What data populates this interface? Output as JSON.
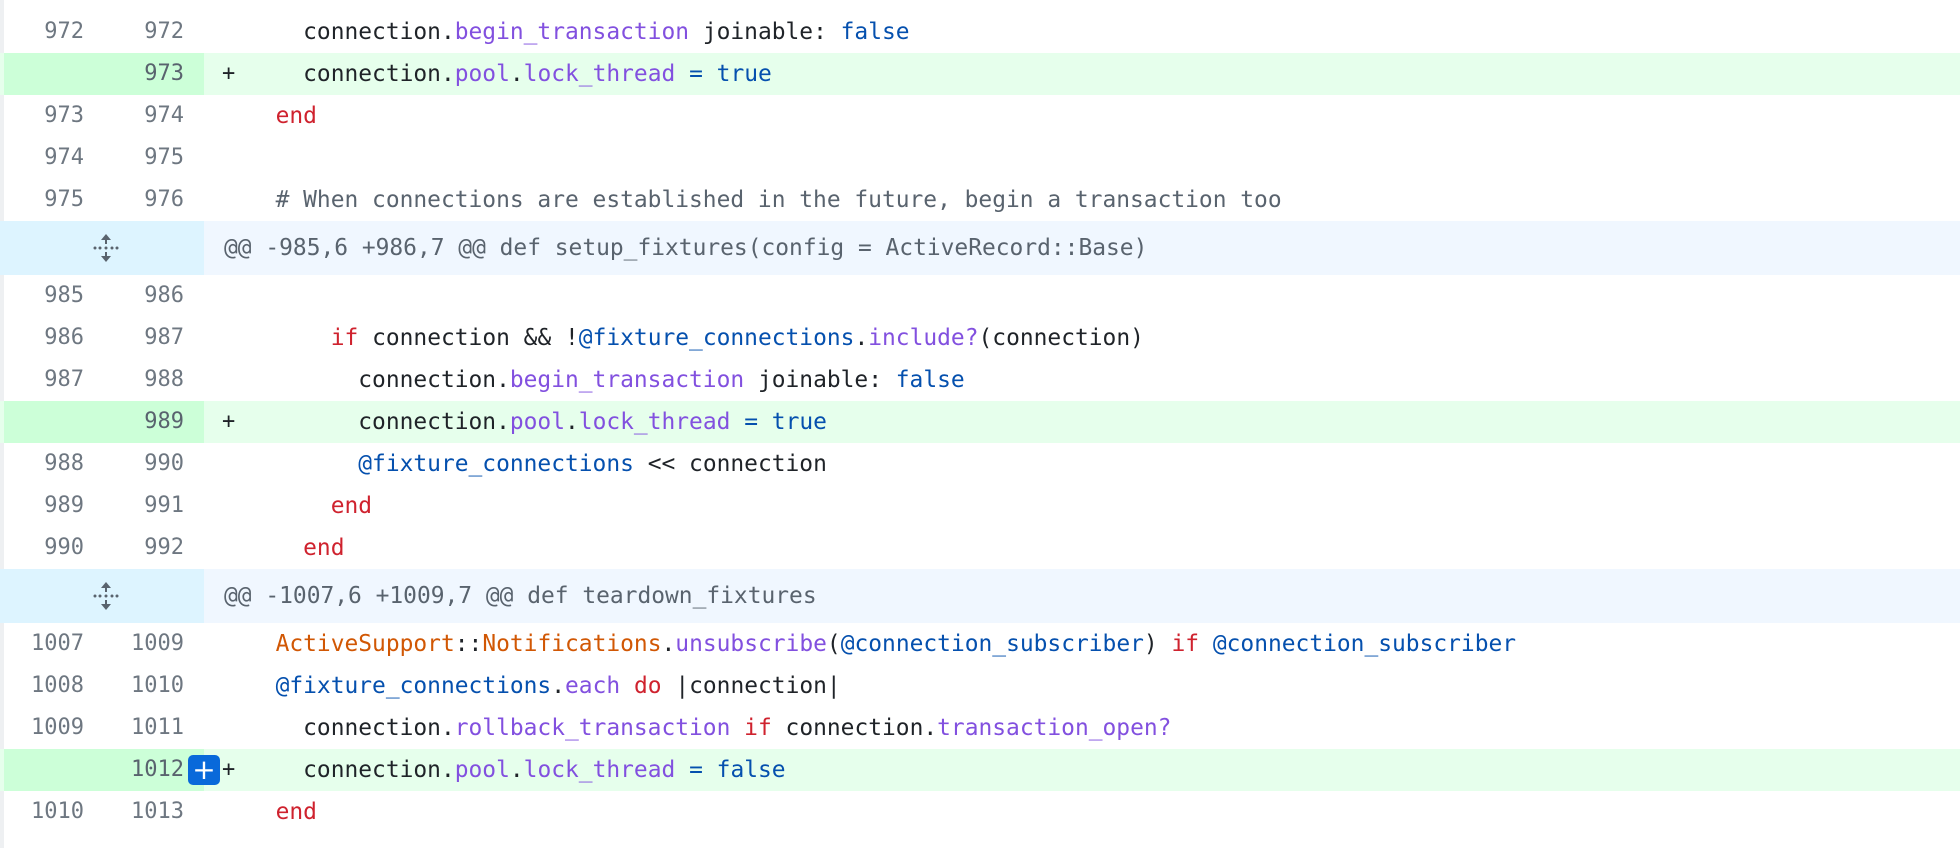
{
  "colors": {
    "keyword": "#cf222e",
    "method": "#8250df",
    "constant": "#0550ae",
    "instance_var": "#0550ae",
    "class_name": "#d15704",
    "comment": "#59636e",
    "added_background": "#e6ffec",
    "added_gutter": "#ccffd8",
    "hunk_background": "#f0f7ff",
    "add_comment_button": "#0969da"
  },
  "icons": {
    "expand": "expand-arrows-icon",
    "add_comment": "plus-icon"
  },
  "add_button_label": "+",
  "lines": [
    {
      "type": "ctx",
      "old": "972",
      "new": "972",
      "marker": "",
      "tokens": [
        {
          "t": "    connection."
        },
        {
          "t": "begin_transaction",
          "c": "mt"
        },
        {
          "t": " joinable: "
        },
        {
          "t": "false",
          "c": "const"
        }
      ]
    },
    {
      "type": "add",
      "old": "",
      "new": "973",
      "marker": "+",
      "tokens": [
        {
          "t": "    connection."
        },
        {
          "t": "pool",
          "c": "mt"
        },
        {
          "t": "."
        },
        {
          "t": "lock_thread",
          "c": "mt"
        },
        {
          "t": " "
        },
        {
          "t": "=",
          "c": "const"
        },
        {
          "t": " "
        },
        {
          "t": "true",
          "c": "const"
        }
      ]
    },
    {
      "type": "ctx",
      "old": "973",
      "new": "974",
      "marker": "",
      "tokens": [
        {
          "t": "  "
        },
        {
          "t": "end",
          "c": "kw"
        }
      ]
    },
    {
      "type": "ctx",
      "old": "974",
      "new": "975",
      "marker": "",
      "tokens": []
    },
    {
      "type": "ctx",
      "old": "975",
      "new": "976",
      "marker": "",
      "tokens": [
        {
          "t": "  "
        },
        {
          "t": "# When connections are established in the future, begin a transaction too",
          "c": "cm"
        }
      ]
    },
    {
      "type": "hunk",
      "text": "@@ -985,6 +986,7 @@ def setup_fixtures(config = ActiveRecord::Base)"
    },
    {
      "type": "ctx",
      "old": "985",
      "new": "986",
      "marker": "",
      "tokens": []
    },
    {
      "type": "ctx",
      "old": "986",
      "new": "987",
      "marker": "",
      "tokens": [
        {
          "t": "      "
        },
        {
          "t": "if",
          "c": "kw"
        },
        {
          "t": " connection && !"
        },
        {
          "t": "@fixture_connections",
          "c": "iv"
        },
        {
          "t": "."
        },
        {
          "t": "include?",
          "c": "mt"
        },
        {
          "t": "(connection)"
        }
      ]
    },
    {
      "type": "ctx",
      "old": "987",
      "new": "988",
      "marker": "",
      "tokens": [
        {
          "t": "        connection."
        },
        {
          "t": "begin_transaction",
          "c": "mt"
        },
        {
          "t": " joinable: "
        },
        {
          "t": "false",
          "c": "const"
        }
      ]
    },
    {
      "type": "add",
      "old": "",
      "new": "989",
      "marker": "+",
      "tokens": [
        {
          "t": "        connection."
        },
        {
          "t": "pool",
          "c": "mt"
        },
        {
          "t": "."
        },
        {
          "t": "lock_thread",
          "c": "mt"
        },
        {
          "t": " "
        },
        {
          "t": "=",
          "c": "const"
        },
        {
          "t": " "
        },
        {
          "t": "true",
          "c": "const"
        }
      ]
    },
    {
      "type": "ctx",
      "old": "988",
      "new": "990",
      "marker": "",
      "tokens": [
        {
          "t": "        "
        },
        {
          "t": "@fixture_connections",
          "c": "iv"
        },
        {
          "t": " << connection"
        }
      ]
    },
    {
      "type": "ctx",
      "old": "989",
      "new": "991",
      "marker": "",
      "tokens": [
        {
          "t": "      "
        },
        {
          "t": "end",
          "c": "kw"
        }
      ]
    },
    {
      "type": "ctx",
      "old": "990",
      "new": "992",
      "marker": "",
      "tokens": [
        {
          "t": "    "
        },
        {
          "t": "end",
          "c": "kw"
        }
      ]
    },
    {
      "type": "hunk",
      "text": "@@ -1007,6 +1009,7 @@ def teardown_fixtures"
    },
    {
      "type": "ctx",
      "old": "1007",
      "new": "1009",
      "marker": "",
      "tokens": [
        {
          "t": "  "
        },
        {
          "t": "ActiveSupport",
          "c": "cls"
        },
        {
          "t": "::"
        },
        {
          "t": "Notifications",
          "c": "cls"
        },
        {
          "t": "."
        },
        {
          "t": "unsubscribe",
          "c": "mt"
        },
        {
          "t": "("
        },
        {
          "t": "@connection_subscriber",
          "c": "iv"
        },
        {
          "t": ") "
        },
        {
          "t": "if",
          "c": "kw"
        },
        {
          "t": " "
        },
        {
          "t": "@connection_subscriber",
          "c": "iv"
        }
      ]
    },
    {
      "type": "ctx",
      "old": "1008",
      "new": "1010",
      "marker": "",
      "tokens": [
        {
          "t": "  "
        },
        {
          "t": "@fixture_connections",
          "c": "iv"
        },
        {
          "t": "."
        },
        {
          "t": "each",
          "c": "mt"
        },
        {
          "t": " "
        },
        {
          "t": "do",
          "c": "kw"
        },
        {
          "t": " |connection|"
        }
      ]
    },
    {
      "type": "ctx",
      "old": "1009",
      "new": "1011",
      "marker": "",
      "tokens": [
        {
          "t": "    connection."
        },
        {
          "t": "rollback_transaction",
          "c": "mt"
        },
        {
          "t": " "
        },
        {
          "t": "if",
          "c": "kw"
        },
        {
          "t": " connection."
        },
        {
          "t": "transaction_open?",
          "c": "mt"
        }
      ]
    },
    {
      "type": "add",
      "old": "",
      "new": "1012",
      "marker": "+",
      "button": true,
      "tokens": [
        {
          "t": "    connection."
        },
        {
          "t": "pool",
          "c": "mt"
        },
        {
          "t": "."
        },
        {
          "t": "lock_thread",
          "c": "mt"
        },
        {
          "t": " "
        },
        {
          "t": "=",
          "c": "const"
        },
        {
          "t": " "
        },
        {
          "t": "false",
          "c": "const"
        }
      ]
    },
    {
      "type": "ctx",
      "old": "1010",
      "new": "1013",
      "marker": "",
      "tokens": [
        {
          "t": "  "
        },
        {
          "t": "end",
          "c": "kw"
        }
      ]
    }
  ]
}
